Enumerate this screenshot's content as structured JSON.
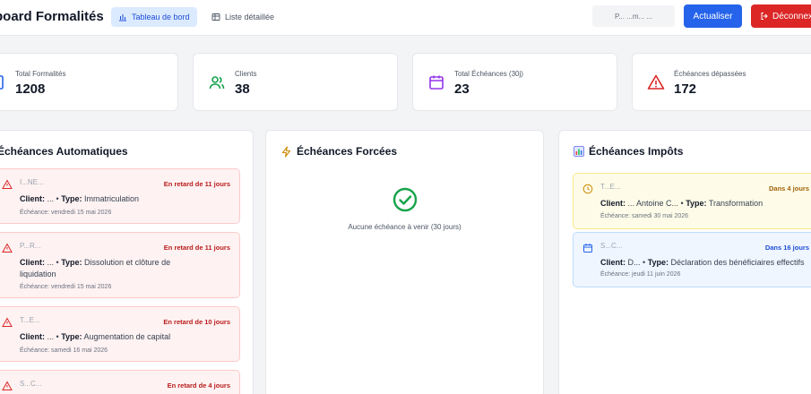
{
  "header": {
    "app_title": "board Formalités",
    "nav": [
      {
        "label": "Tableau de bord",
        "icon": "bar-chart-icon",
        "active": true
      },
      {
        "label": "Liste détaillée",
        "icon": "table-icon",
        "active": false
      }
    ],
    "user_text": "P... ...m... ...",
    "refresh_label": "Actualiser",
    "logout_label": "Déconnex"
  },
  "stats": [
    {
      "label": "Total Formalités",
      "value": "1208",
      "icon": "document-icon",
      "color": "#2563eb"
    },
    {
      "label": "Clients",
      "value": "38",
      "icon": "users-icon",
      "color": "#16a34a"
    },
    {
      "label": "Total Échéances (30j)",
      "value": "23",
      "icon": "calendar-icon",
      "color": "#9333ea"
    },
    {
      "label": "Échéances dépassées",
      "value": "172",
      "icon": "warning-icon",
      "color": "#dc2626"
    }
  ],
  "panels": {
    "auto": {
      "title": "Échéances Automatiques",
      "items": [
        {
          "name": "I...NE...",
          "badge": "En retard de 11 jours",
          "client_label": "Client:",
          "client": "...",
          "type_label": "Type:",
          "type": "Immatriculation",
          "date": "Échéance: vendredi 15 mai 2026"
        },
        {
          "name": "P...R...",
          "badge": "En retard de 11 jours",
          "client_label": "Client:",
          "client": "...",
          "type_label": "Type:",
          "type": "Dissolution et clôture de liquidation",
          "date": "Échéance: vendredi 15 mai 2026"
        },
        {
          "name": "T...E...",
          "badge": "En retard de 10 jours",
          "client_label": "Client:",
          "client": "...",
          "type_label": "Type:",
          "type": "Augmentation de capital",
          "date": "Échéance: samedi 16 mai 2026"
        },
        {
          "name": "S...C...",
          "badge": "En retard de 4 jours"
        }
      ]
    },
    "forced": {
      "title": "Échéances Forcées",
      "empty_text": "Aucune échéance à venir (30 jours)"
    },
    "taxes": {
      "title": "Échéances Impôts",
      "items": [
        {
          "name": "T...E...",
          "badge": "Dans 4 jours",
          "client_label": "Client:",
          "client": "... Antoine C...",
          "type_label": "Type:",
          "type": "Transformation",
          "date": "Échéance: samedi 30 mai 2026"
        },
        {
          "name": "S...C...",
          "badge": "Dans 16 jours",
          "client_label": "Client:",
          "client": "D...",
          "type_label": "Type:",
          "type": "Déclaration des bénéficiaires effectifs",
          "date": "Échéance: jeudi 11 juin 2026"
        }
      ]
    }
  }
}
